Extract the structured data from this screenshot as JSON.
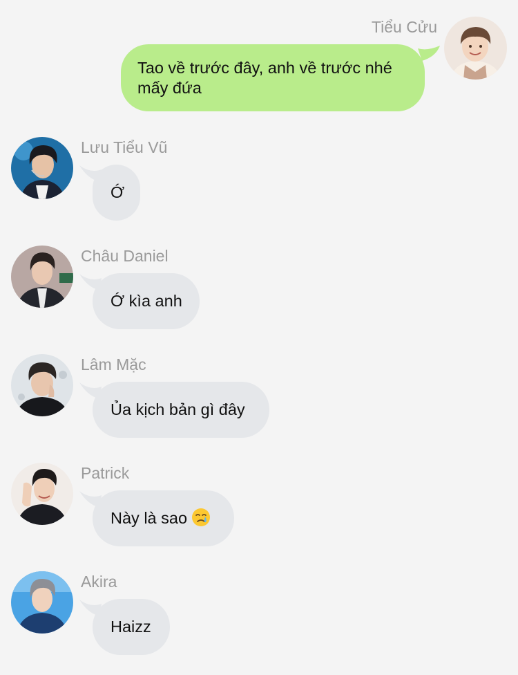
{
  "conversation": {
    "messages": [
      {
        "direction": "outgoing",
        "sender": "Tiểu Cửu",
        "text": "Tao về trước đây, anh về trước nhé mấy đứa",
        "avatar": "boy-smiling-light-sweater-avatar"
      },
      {
        "direction": "incoming",
        "sender": "Lưu Tiểu Vũ",
        "text": "Ớ",
        "avatar": "boy-blue-stage-headset-avatar"
      },
      {
        "direction": "incoming",
        "sender": "Châu Daniel",
        "text": "Ớ kìa anh",
        "avatar": "man-dark-suit-avatar"
      },
      {
        "direction": "incoming",
        "sender": "Lâm Mặc",
        "text": "Ủa kịch bản gì đây",
        "avatar": "boy-hand-on-face-avatar"
      },
      {
        "direction": "incoming",
        "sender": "Patrick",
        "text": "Này là sao",
        "emoji": "crying-face-emoji",
        "avatar": "boy-waving-hand-avatar"
      },
      {
        "direction": "incoming",
        "sender": "Akira",
        "text": "Haizz",
        "avatar": "boy-blue-background-avatar"
      }
    ]
  },
  "colors": {
    "background": "#f4f4f4",
    "outgoing_bubble": "#b9ec8b",
    "incoming_bubble": "#e5e7ea",
    "sender_name": "#9a9a9a",
    "message_text": "#111111"
  }
}
